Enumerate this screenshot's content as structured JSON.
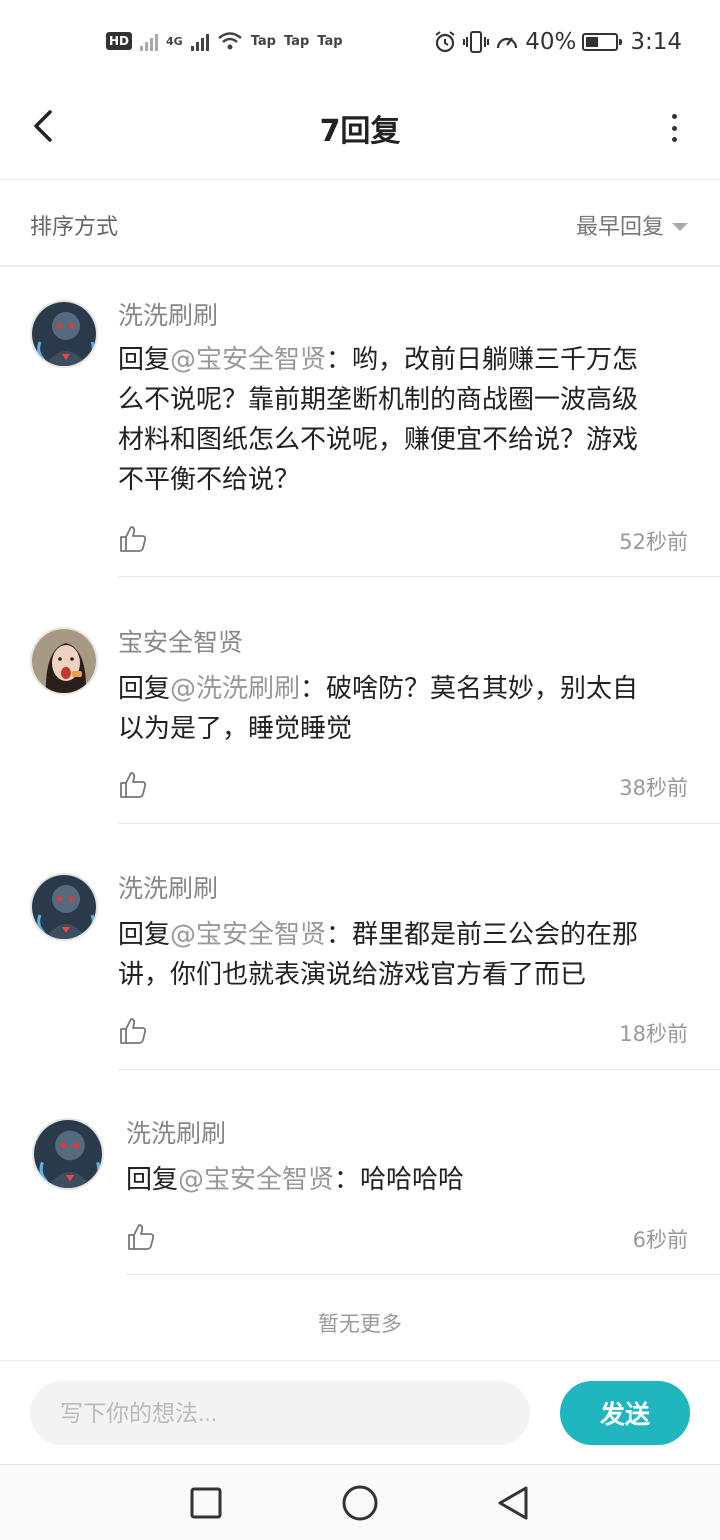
{
  "status_bar": {
    "left_badge": "HD",
    "network": "4G",
    "tap_labels": [
      "Tap",
      "Tap",
      "Tap"
    ],
    "battery_percent_text": "40%",
    "battery_level": 0.4,
    "time": "3:14"
  },
  "header": {
    "title": "7回复"
  },
  "sort": {
    "label": "排序方式",
    "value": "最早回复"
  },
  "comments": [
    {
      "username": "洗洗刷刷",
      "reply_prefix": "回复",
      "mention": "@宝安全智贤",
      "separator": "：",
      "text_line1": "哟，改前日躺赚三千万怎",
      "text_lines": [
        "么不说呢？靠前期垄断机制的商战圈一波高级",
        "材料和图纸怎么不说呢，赚便宜不给说？游戏",
        "不平衡不给说？"
      ],
      "time": "52秒前",
      "avatar_icon": "robot-avatar"
    },
    {
      "username": "宝安全智贤",
      "reply_prefix": "回复",
      "mention": "@洗洗刷刷",
      "separator": "：",
      "text_line1": "破啥防？莫名其妙，别太自",
      "text_lines": [
        "以为是了，睡觉睡觉"
      ],
      "time": "38秒前",
      "avatar_icon": "girl-avatar"
    },
    {
      "username": "洗洗刷刷",
      "reply_prefix": "回复",
      "mention": "@宝安全智贤",
      "separator": "：",
      "text_line1": "群里都是前三公会的在那",
      "text_lines": [
        "讲，你们也就表演说给游戏官方看了而已"
      ],
      "time": "18秒前",
      "avatar_icon": "robot-avatar"
    },
    {
      "username": "洗洗刷刷",
      "reply_prefix": "回复",
      "mention": "@宝安全智贤",
      "separator": "：",
      "text_line1": "哈哈哈哈",
      "text_lines": [],
      "time": "6秒前",
      "avatar_icon": "robot-avatar"
    }
  ],
  "footer_note": "暂无更多",
  "input": {
    "placeholder": "写下你的想法...",
    "send_label": "发送"
  },
  "colors": {
    "accent": "#1fb6c0",
    "mention": "#999999"
  }
}
